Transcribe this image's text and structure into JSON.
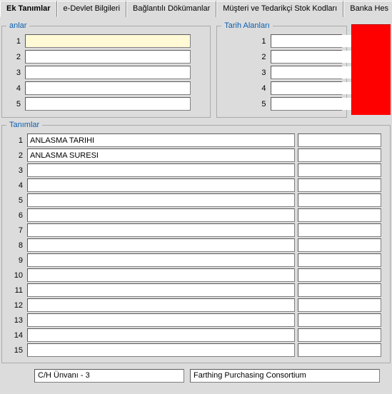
{
  "tabs": {
    "t1": "Ek Tanımlar",
    "t2": "e-Devlet Bilgileri",
    "t3": "Bağlantılı Dökümanlar",
    "t4": "Müşteri ve Tedarikçi Stok Kodları",
    "t5": "Banka Hes"
  },
  "group1": {
    "legend": "anlar"
  },
  "group2": {
    "legend": "Tarih Alanları"
  },
  "group3": {
    "legend": "Tanımlar"
  },
  "nums": {
    "n1": "1",
    "n2": "2",
    "n3": "3",
    "n4": "4",
    "n5": "5",
    "n6": "6",
    "n7": "7",
    "n8": "8",
    "n9": "9",
    "n10": "10",
    "n11": "11",
    "n12": "12",
    "n13": "13",
    "n14": "14",
    "n15": "15"
  },
  "defs": {
    "d1": "ANLASMA TARIHI",
    "d2": "ANLASMA SURESI",
    "d3": "",
    "d4": "",
    "d5": "",
    "d6": "",
    "d7": "",
    "d8": "",
    "d9": "",
    "d10": "",
    "d11": "",
    "d12": "",
    "d13": "",
    "d14": "",
    "d15": ""
  },
  "vals": {
    "v1": "",
    "v2": "",
    "v3": "",
    "v4": "",
    "v5": "",
    "v6": "",
    "v7": "",
    "v8": "",
    "v9": "",
    "v10": "",
    "v11": "",
    "v12": "",
    "v13": "",
    "v14": "",
    "v15": ""
  },
  "leftInputs": {
    "i1": "",
    "i2": "",
    "i3": "",
    "i4": "",
    "i5": ""
  },
  "dateInputs": {
    "i1": "",
    "i2": "",
    "i3": "",
    "i4": "",
    "i5": ""
  },
  "footer": {
    "label": "C/H Ünvanı - 3",
    "value": "Farthing Purchasing Consortium"
  }
}
